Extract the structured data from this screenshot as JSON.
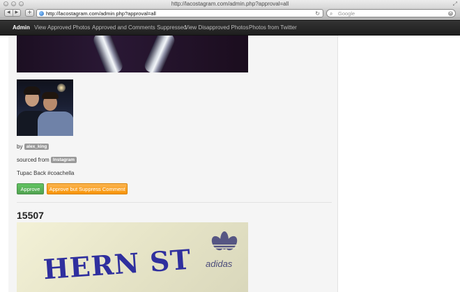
{
  "window": {
    "title": "http://lacostagram.com/admin.php?approval=all"
  },
  "toolbar": {
    "back_glyph": "◀",
    "forward_glyph": "▶",
    "add_glyph": "+",
    "url": "http://lacostagram.com/admin.php?approval=all",
    "reload_glyph": "↻",
    "search_placeholder": "Google"
  },
  "nav": {
    "brand": "Admin",
    "items": [
      "View Approved Photos",
      "Approved and Comments Suppressed",
      "View Disapproved Photos",
      "Photos from Twitter"
    ]
  },
  "post": {
    "by_label": "by",
    "username": "alex_king",
    "sourced_label": "sourced from",
    "source": "Instagram",
    "caption": "Tupac Back #coachella",
    "approve_label": "Approve",
    "approve_suppress_label": "Approve but Suppress Comment"
  },
  "next_post": {
    "id": "15507",
    "image_text": "HERN ST",
    "brand_text": "adidas"
  },
  "colors": {
    "approve": "#5bb75b",
    "approve_suppress": "#f89406",
    "nav_bg": "#2c2c2c",
    "tag_bg": "#999999"
  },
  "icons": {
    "globe": "globe-icon",
    "search": "search-icon",
    "reload": "reload-icon"
  }
}
